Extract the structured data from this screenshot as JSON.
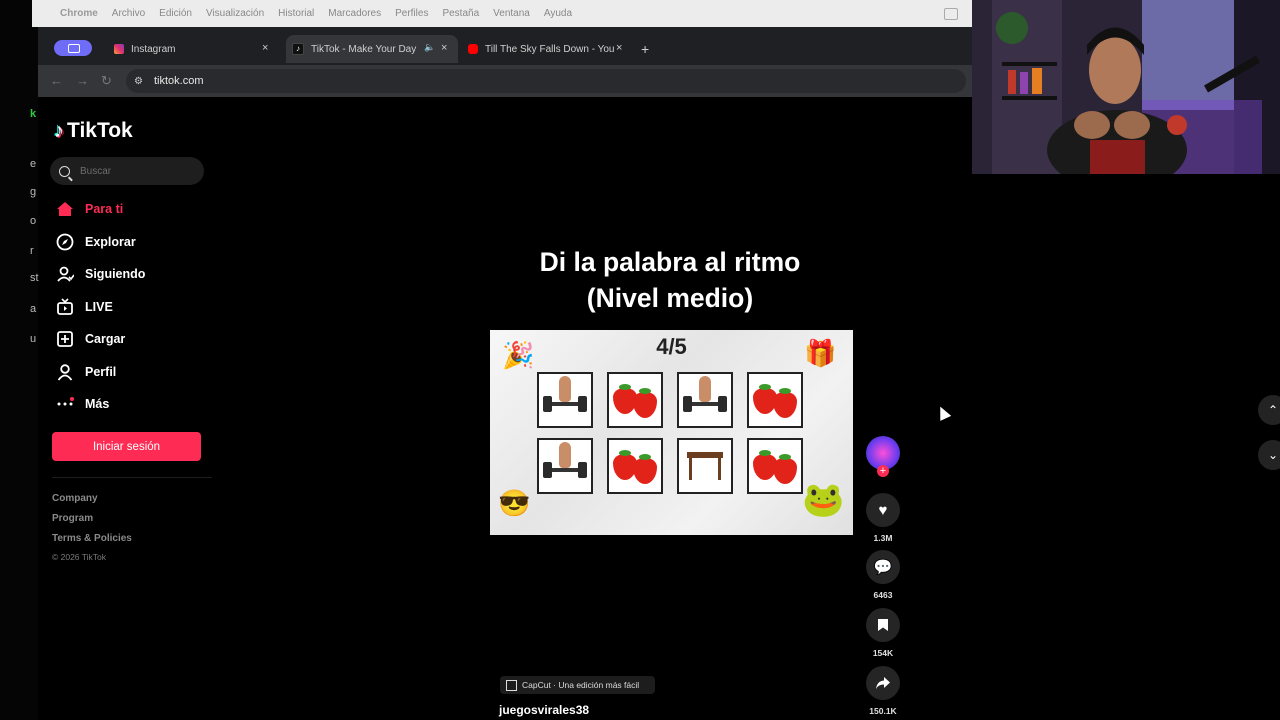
{
  "browser": {
    "menubar": [
      "Chrome",
      "Archivo",
      "Edición",
      "Visualización",
      "Historial",
      "Marcadores",
      "Perfiles",
      "Pestaña",
      "Ventana",
      "Ayuda"
    ],
    "tabs": [
      {
        "title": "Instagram"
      },
      {
        "title": "TikTok - Make Your Day"
      },
      {
        "title": "Till The Sky Falls Down - You"
      }
    ],
    "new_tab": "+",
    "url": "tiktok.com"
  },
  "sidebar": {
    "brand": "TikTok",
    "search_placeholder": "Buscar",
    "nav": [
      {
        "label": "Para ti",
        "icon": "home-icon"
      },
      {
        "label": "Explorar",
        "icon": "compass-icon"
      },
      {
        "label": "Siguiendo",
        "icon": "following-icon"
      },
      {
        "label": "LIVE",
        "icon": "live-tv-icon"
      },
      {
        "label": "Cargar",
        "icon": "upload-icon"
      },
      {
        "label": "Perfil",
        "icon": "profile-icon"
      },
      {
        "label": "Más",
        "icon": "more-icon"
      }
    ],
    "login": "Iniciar sesión",
    "footer": [
      "Company",
      "Program",
      "Terms & Policies"
    ],
    "copyright": "© 2026 TikTok"
  },
  "video": {
    "title_line1": "Di la palabra al ritmo",
    "title_line2": "(Nivel medio)",
    "counter": "4/5",
    "grid": [
      "dumbbell",
      "strawberry",
      "dumbbell",
      "strawberry",
      "dumbbell",
      "strawberry",
      "table",
      "strawberry"
    ],
    "capcut": "CapCut · Una edición más fácil",
    "author": "juegosvirales38"
  },
  "actions": {
    "likes": "1.3M",
    "comments": "6463",
    "saves": "154K",
    "shares": "150.1K"
  },
  "colors": {
    "accent": "#fe2c55",
    "background": "#000000"
  }
}
